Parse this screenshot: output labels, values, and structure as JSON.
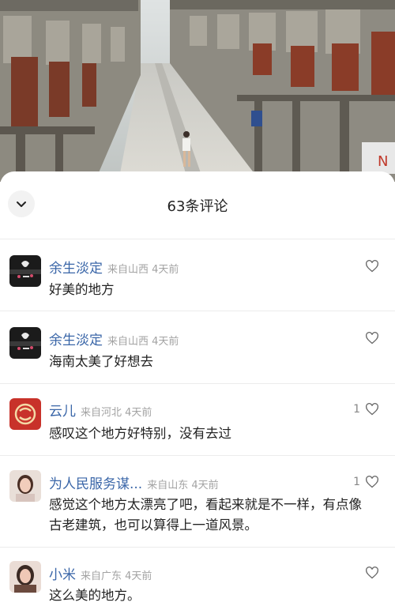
{
  "header": {
    "title": "63条评论"
  },
  "comments": [
    {
      "name": "余生淡定",
      "meta": "来自山西 4天前",
      "text": "好美的地方",
      "likes": ""
    },
    {
      "name": "余生淡定",
      "meta": "来自山西 4天前",
      "text": "海南太美了好想去",
      "likes": ""
    },
    {
      "name": "云儿",
      "meta": "来自河北 4天前",
      "text": "感叹这个地方好特别，没有去过",
      "likes": "1"
    },
    {
      "name": "为人民服务谋...",
      "meta": "来自山东 4天前",
      "text": "感觉这个地方太漂亮了吧，看起来就是不一样，有点像古老建筑，也可以算得上一道风景。",
      "likes": "1"
    },
    {
      "name": "小米",
      "meta": "来自广东 4天前",
      "text": "这么美的地方。",
      "likes": ""
    }
  ],
  "video": {
    "sign_text": "N"
  },
  "colors": {
    "name": "#3a66a8",
    "meta": "#a3a3a3",
    "divider": "#ececec"
  },
  "icons": [
    "chevron-down-icon",
    "heart-outline-icon"
  ]
}
